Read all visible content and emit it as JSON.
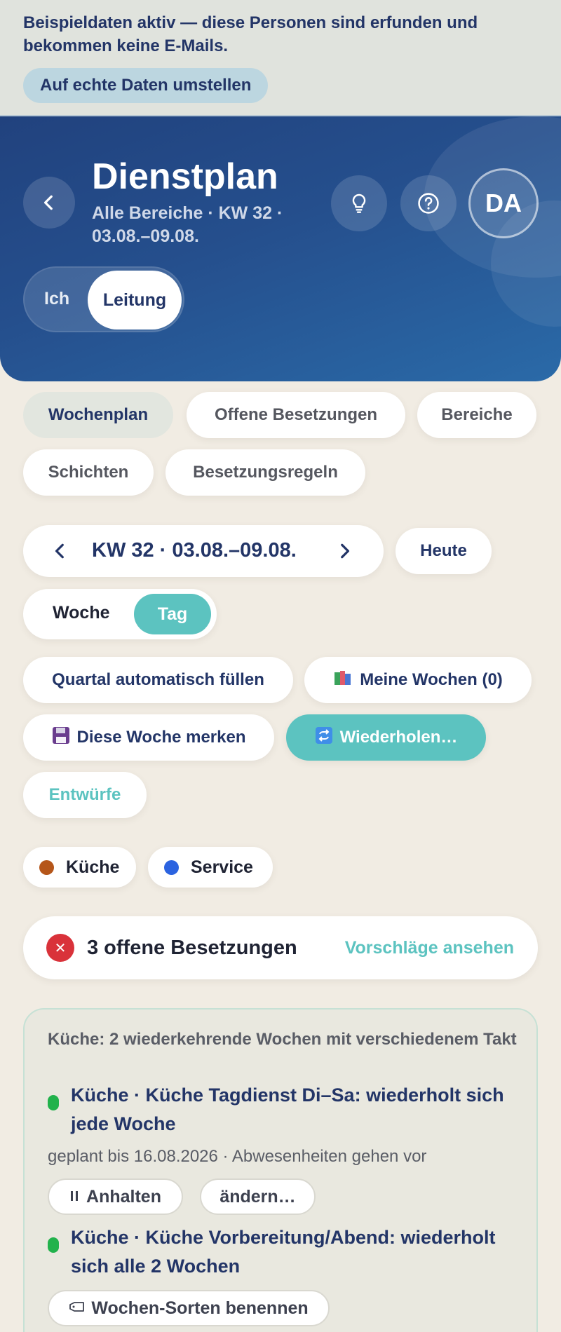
{
  "banner": {
    "text": "Beispieldaten aktiv — diese Personen sind erfunden und bekommen keine E-Mails.",
    "button": "Auf echte Daten umstellen"
  },
  "header": {
    "title": "Dienstplan",
    "subtitle": "Alle Bereiche · KW 32 · 03.08.–09.08.",
    "avatar": "DA",
    "roles": {
      "self": "Ich",
      "lead": "Leitung",
      "selected": "Leitung"
    }
  },
  "tabs": [
    {
      "label": "Wochenplan",
      "active": true
    },
    {
      "label": "Offene Besetzungen"
    },
    {
      "label": "Bereiche"
    },
    {
      "label": "Schichten"
    },
    {
      "label": "Besetzungsregeln"
    }
  ],
  "week": {
    "label": "KW 32 · 03.08.–09.08.",
    "today": "Heute"
  },
  "view": {
    "week": "Woche",
    "day": "Tag",
    "selected": "Tag"
  },
  "actions": {
    "autofill": "Quartal automatisch füllen",
    "my_weeks": "Meine Wochen (0)",
    "save_week": "Diese Woche merken",
    "repeat": "Wiederholen…",
    "drafts": "Entwürfe"
  },
  "areas": [
    {
      "label": "Küche",
      "color": "#b5561a"
    },
    {
      "label": "Service",
      "color": "#2b63e0"
    }
  ],
  "open_shifts": {
    "text": "3 offene Besetzungen",
    "link": "Vorschläge ansehen"
  },
  "recurring": {
    "heading": "Küche: 2 wiederkehrende Wochen mit verschiedenem Takt",
    "items": [
      {
        "title": "Küche · Küche Tagdienst Di–Sa: wiederholt sich jede Woche",
        "meta": "geplant bis 16.08.2026 · Abwesenheiten gehen vor",
        "pause": "Anhalten",
        "edit": "ändern…"
      },
      {
        "title": "Küche · Küche Vorbereitung/Abend: wiederholt sich alle 2 Wochen",
        "name_weeks": "Wochen-Sorten benennen"
      }
    ]
  }
}
